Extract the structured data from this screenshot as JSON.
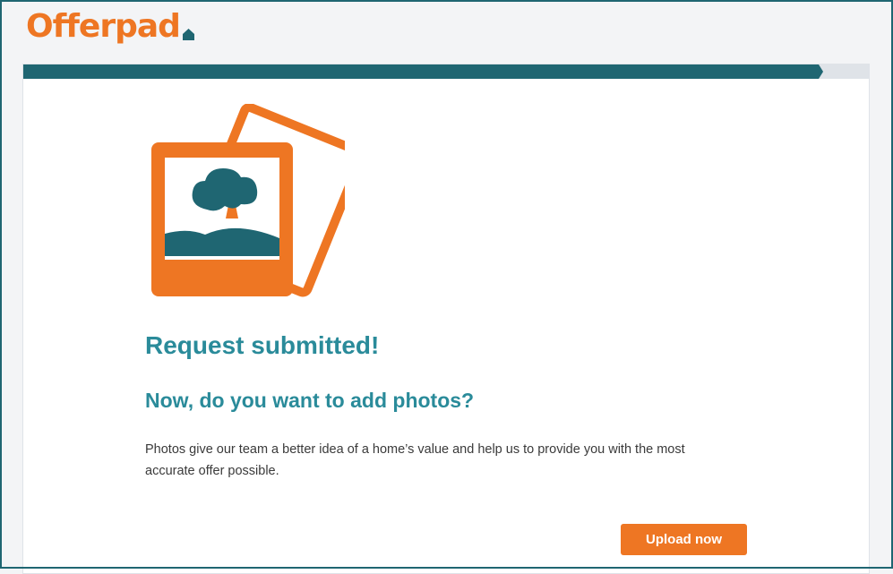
{
  "brand": {
    "name": "Offerpad",
    "accent": "#ee7623",
    "teal": "#1f6672"
  },
  "progress": {
    "percent": 94.6
  },
  "illustration": {
    "icon": "photos-icon"
  },
  "content": {
    "title": "Request submitted!",
    "subtitle": "Now, do you want to add photos?",
    "body": "Photos give our team a better idea of a home’s value and help us to provide you with the most accurate offer possible."
  },
  "actions": {
    "upload_label": "Upload now"
  }
}
